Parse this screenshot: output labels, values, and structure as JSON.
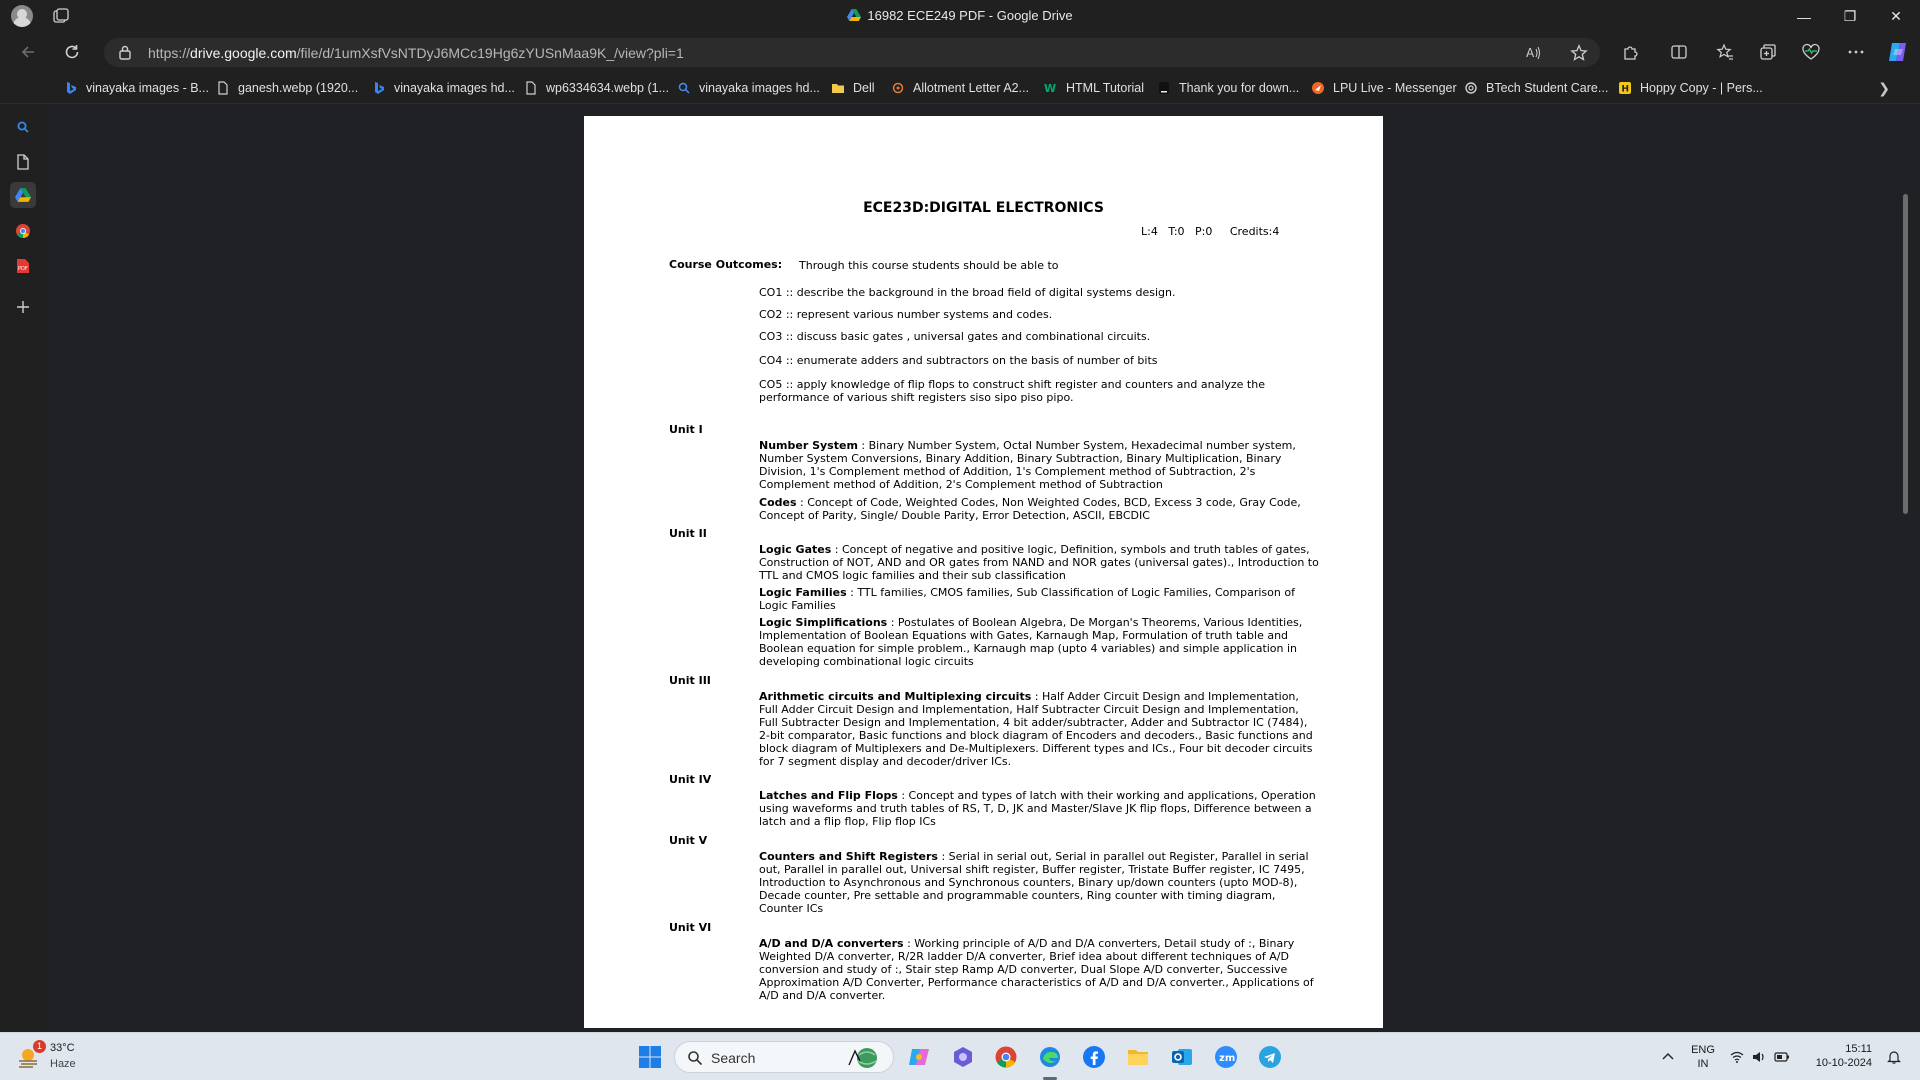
{
  "window": {
    "title": "16982 ECE249 PDF - Google Drive",
    "controls": {
      "minimize": "—",
      "restore": "❐",
      "close": "✕"
    }
  },
  "address_bar": {
    "url_prefix": "https://",
    "url_host": "drive.google.com",
    "url_path": "/file/d/1umXsfVsNTDyJ6MCc19Hg6zYUSnMaa9K_/view?pli=1"
  },
  "bookmarks": [
    {
      "label": "vinayaka images - B...",
      "icon": "bing-icon",
      "color": "#3b82f6"
    },
    {
      "label": "ganesh.webp (1920...",
      "icon": "file-icon",
      "color": "#d0d0d0"
    },
    {
      "label": "vinayaka images hd...",
      "icon": "bing-icon",
      "color": "#3b82f6"
    },
    {
      "label": "wp6334634.webp (1...",
      "icon": "file-icon",
      "color": "#d0d0d0"
    },
    {
      "label": "vinayaka images hd...",
      "icon": "search-icon",
      "color": "#4c8bf5"
    },
    {
      "label": "Dell",
      "icon": "folder-icon",
      "color": "#f2c94c"
    },
    {
      "label": "Allotment Letter A2...",
      "icon": "globe-icon",
      "color": "#e07a3a"
    },
    {
      "label": "HTML Tutorial",
      "icon": "w3schools-icon",
      "color": "#04aa6d"
    },
    {
      "label": "Thank you for down...",
      "icon": "page-icon",
      "color": "#111111"
    },
    {
      "label": "LPU Live - Messenger",
      "icon": "lpu-icon",
      "color": "#f26522"
    },
    {
      "label": "BTech Student Care...",
      "icon": "openai-icon",
      "color": "#d0d0d0"
    },
    {
      "label": "Hoppy Copy - | Pers...",
      "icon": "hoppy-icon",
      "color": "#f5c518"
    }
  ],
  "document": {
    "title": "ECE23D:DIGITAL ELECTRONICS",
    "ltp": "L:4   T:0   P:0     Credits:4",
    "course_outcomes_heading": "Course Outcomes:",
    "course_outcomes_intro": "Through this course students should be able to",
    "outcomes": [
      "CO1 :: describe the background in the broad field of digital systems design.",
      "CO2 :: represent various number systems and codes.",
      "CO3 :: discuss basic gates , universal gates and combinational circuits.",
      "CO4 :: enumerate adders and subtractors on the basis of number of bits",
      "CO5 :: apply  knowledge of flip flops to construct shift register and counters and analyze the performance of various shift registers siso sipo piso pipo."
    ],
    "units": [
      {
        "label": "Unit I"
      },
      {
        "label": "Unit II"
      },
      {
        "label": "Unit III"
      },
      {
        "label": "Unit IV"
      },
      {
        "label": "Unit V"
      },
      {
        "label": "Unit VI"
      }
    ],
    "topics": [
      {
        "head": "Number System",
        "text": " : Binary Number System, Octal Number System, Hexadecimal number system, Number System Conversions, Binary Addition, Binary Subtraction, Binary Multiplication, Binary Division, 1's Complement method of Addition, 1's Complement method of Subtraction, 2's Complement method of Addition, 2's Complement method of Subtraction"
      },
      {
        "head": "Codes",
        "text": " : Concept of Code, Weighted Codes, Non Weighted Codes, BCD, Excess 3 code, Gray Code, Concept of Parity, Single/ Double Parity, Error Detection, ASCII, EBCDIC"
      },
      {
        "head": "Logic Gates",
        "text": " : Concept of negative and positive logic, Definition, symbols and truth tables of gates, Construction of NOT, AND and OR gates from NAND and NOR gates (universal gates)., Introduction to TTL and CMOS logic families and their sub classification"
      },
      {
        "head": "Logic Families",
        "text": " : TTL families, CMOS families, Sub Classification of Logic Families, Comparison of Logic Families"
      },
      {
        "head": "Logic Simplifications",
        "text": " : Postulates of Boolean Algebra, De Morgan's Theorems, Various Identities, Implementation of Boolean Equations with Gates, Karnaugh Map, Formulation of truth table and Boolean equation for simple problem., Karnaugh map (upto 4 variables) and simple application in developing combinational logic circuits"
      },
      {
        "head": "Arithmetic circuits and Multiplexing circuits",
        "text": " : Half Adder Circuit Design and Implementation, Full Adder Circuit Design and Implementation, Half Subtracter Circuit Design and Implementation, Full Subtracter Design and Implementation, 4 bit adder/subtracter, Adder and Subtractor IC (7484), 2-bit comparator, Basic functions and block diagram of Encoders and decoders., Basic functions and block diagram of Multiplexers and De-Multiplexers. Different types and ICs., Four bit decoder circuits for 7 segment display and decoder/driver ICs."
      },
      {
        "head": "Latches and Flip Flops",
        "text": " : Concept and types of latch with their working and applications, Operation using waveforms and truth tables of RS, T, D, JK and Master/Slave JK flip flops, Difference between a latch and a flip flop, Flip flop ICs"
      },
      {
        "head": "Counters and Shift Registers",
        "text": " : Serial in serial out, Serial in parallel out Register, Parallel in serial out, Parallel in parallel out, Universal shift register, Buffer register, Tristate Buffer register, IC 7495, Introduction to Asynchronous and Synchronous counters, Binary up/down counters (upto MOD-8), Decade counter, Pre settable and programmable counters, Ring counter with timing diagram, Counter ICs"
      },
      {
        "head": "A/D and D/A converters",
        "text": " : Working principle of A/D and D/A converters, Detail study of :, Binary Weighted D/A converter, R/2R ladder D/A converter, Brief idea about different techniques of A/D conversion and study of :, Stair step Ramp A/D converter, Dual Slope A/D converter, Successive Approximation A/D Converter, Performance characteristics of A/D and D/A converter., Applications of A/D and D/A converter."
      }
    ]
  },
  "taskbar": {
    "weather_badge": "1",
    "temperature": "33°C",
    "condition": "Haze",
    "search_label": "Search",
    "language_line1": "ENG",
    "language_line2": "IN",
    "time": "15:11",
    "date": "10-10-2024"
  }
}
